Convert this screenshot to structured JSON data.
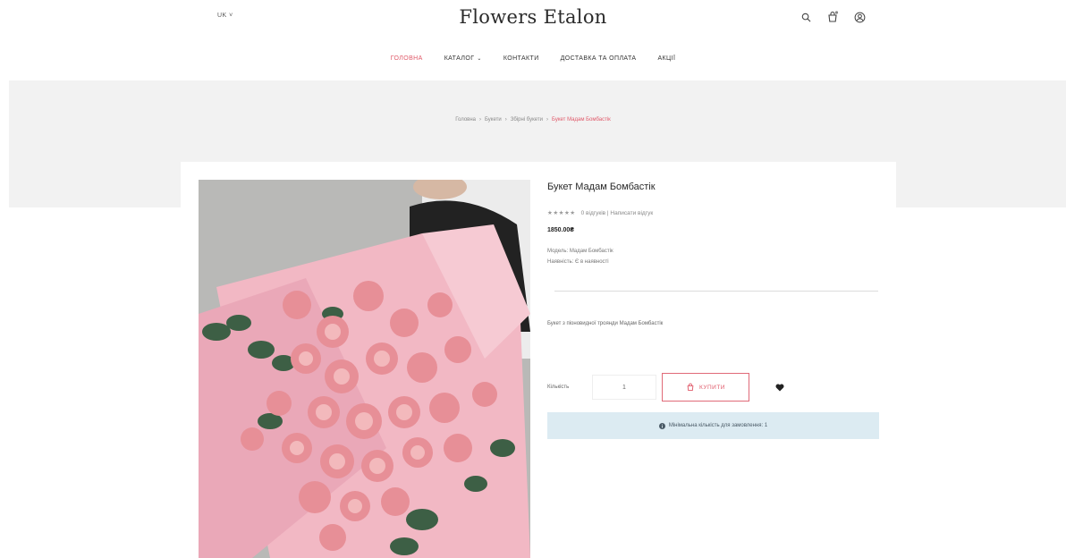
{
  "header": {
    "lang": "UK ˅",
    "logo": "Flowers Etalon",
    "icons": [
      "search-icon",
      "cart-icon",
      "account-icon"
    ]
  },
  "nav": [
    {
      "label": "ГОЛОВНА",
      "active": true
    },
    {
      "label": "КАТАЛОГ",
      "dropdown": true
    },
    {
      "label": "КОНТАКТИ"
    },
    {
      "label": "ДОСТАВКА ТА ОПЛАТА"
    },
    {
      "label": "АКЦІЇ"
    }
  ],
  "breadcrumbs": [
    "Головна",
    "Букети",
    "Збірні букети",
    "Букет Мадам Бомбастік"
  ],
  "product": {
    "title": "Букет Мадам Бомбастік",
    "rating_text": "0 відгуків | Написати відгук",
    "price": "1850.00₴",
    "model": "Модель: Мадам Бомбастік",
    "availability": "Наявність: Є в наявності",
    "description": "Букет з піоновидної троянди Мадам Бомбастік",
    "qty_label": "Кількість",
    "qty_value": "1",
    "buy_label": "КУПИТИ",
    "alert": "Мінімальна кількість для замовлення: 1"
  },
  "colors": {
    "accent": "#e05a6a",
    "band": "#f2f2f2",
    "alert_bg": "#dcebf2"
  }
}
